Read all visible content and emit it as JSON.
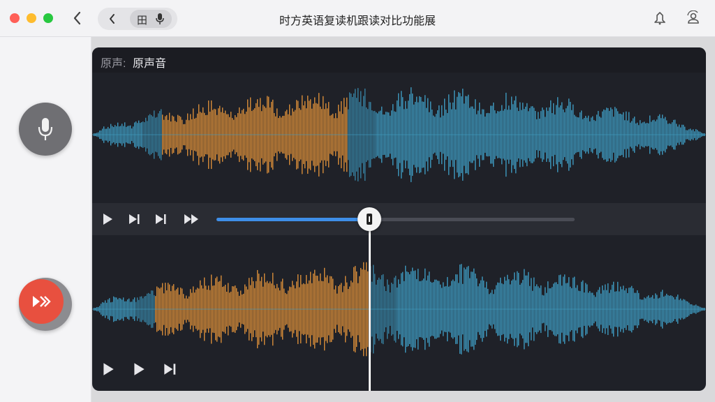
{
  "window": {
    "title": "时方英语复读机跟读对比功能展"
  },
  "toolbar": {
    "pill_char": "田",
    "icons": [
      "chevron-left-icon",
      "chevron-left-icon",
      "mic-icon",
      "bell-icon",
      "user-sync-icon"
    ]
  },
  "sidebar": {
    "record_icon": "mic-icon",
    "play_icon": "fast-forward-play-icon"
  },
  "panel": {
    "header_prefix": "原声:",
    "header_name": "原声音"
  },
  "player": {
    "progress": 0.43,
    "controls_top": [
      "play-icon",
      "skip-next-icon",
      "skip-next-icon",
      "fast-forward-icon"
    ],
    "controls_bottom": [
      "play-icon",
      "play-icon",
      "skip-next-icon"
    ]
  },
  "colors": {
    "orange_wave": "#e0913a",
    "blue_wave": "#3f9fc5",
    "accent_blue": "#3e8ee8",
    "record_red": "#e8503f"
  }
}
